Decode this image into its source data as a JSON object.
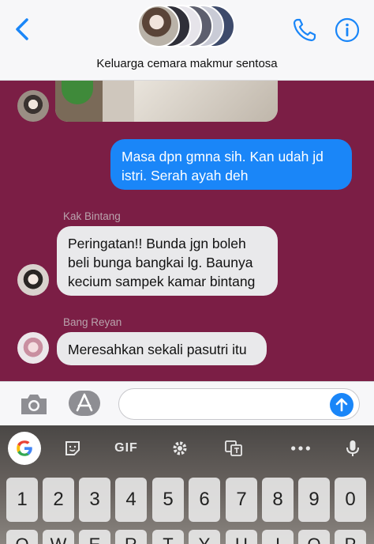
{
  "header": {
    "title": "Keluarga cemara makmur sentosa",
    "accent": "#1a86f8"
  },
  "messages": [
    {
      "direction": "outgoing",
      "text": "Masa dpn gmna sih. Kan udah jd istri. Serah ayah deh"
    },
    {
      "direction": "incoming",
      "sender": "Kak Bintang",
      "text": "Peringatan!! Bunda jgn boleh beli bunga bangkai lg. Baunya kecium sampek kamar bintang"
    },
    {
      "direction": "incoming",
      "sender": "Bang Reyan",
      "text": "Meresahkan sekali pasutri itu"
    }
  ],
  "input": {
    "placeholder": ""
  },
  "keyboard": {
    "toolbar": [
      "google-icon",
      "sticker-icon",
      "GIF",
      "gear-icon",
      "translate-icon",
      "more-icon",
      "mic-icon"
    ],
    "gif_label": "GIF",
    "number_row": [
      "1",
      "2",
      "3",
      "4",
      "5",
      "6",
      "7",
      "8",
      "9",
      "0"
    ],
    "letter_row": [
      "Q",
      "W",
      "E",
      "R",
      "T",
      "Y",
      "U",
      "I",
      "O",
      "P"
    ]
  },
  "colors": {
    "chat_background": "#7b1e45",
    "outgoing_bubble": "#1a86f8",
    "incoming_bubble": "#e9e9eb"
  }
}
